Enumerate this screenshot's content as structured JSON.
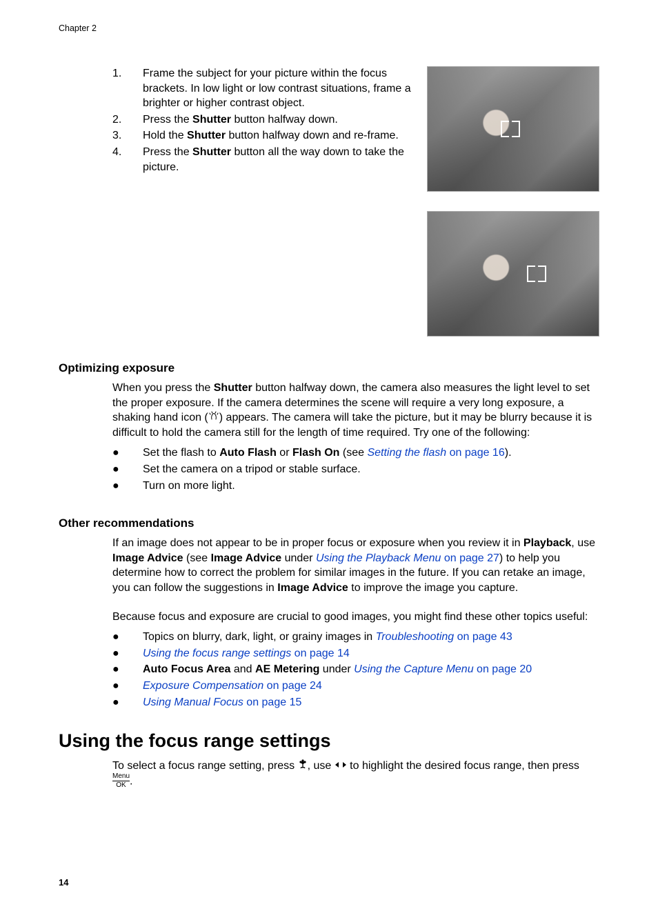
{
  "chapter_label": "Chapter 2",
  "steps": {
    "s1": {
      "num": "1.",
      "text_before": "Frame the subject for your picture within the focus brackets. In low light or low contrast situations, frame a brighter or higher contrast object."
    },
    "s2": {
      "num": "2.",
      "pre": "Press the ",
      "b1": "Shutter",
      "post": " button halfway down."
    },
    "s3": {
      "num": "3.",
      "pre": "Hold the ",
      "b1": "Shutter",
      "post": " button halfway down and re-frame."
    },
    "s4": {
      "num": "4.",
      "pre": "Press the ",
      "b1": "Shutter",
      "post": " button all the way down to take the picture."
    }
  },
  "optimizing": {
    "heading": "Optimizing exposure",
    "para_pre": "When you press the ",
    "para_b1": "Shutter",
    "para_mid": " button halfway down, the camera also measures the light level to set the proper exposure. If the camera determines the scene will require a very long exposure, a shaking hand icon (",
    "para_post": ") appears. The camera will take the picture, but it may be blurry because it is difficult to hold the camera still for the length of time required. Try one of the following:",
    "bullets": {
      "b1_pre": "Set the flash to ",
      "b1_bold1": "Auto Flash",
      "b1_mid": " or ",
      "b1_bold2": "Flash On",
      "b1_see": " (see ",
      "b1_link_em": "Setting the flash",
      "b1_link_tail": " on page 16",
      "b1_close": ").",
      "b2": "Set the camera on a tripod or stable surface.",
      "b3": "Turn on more light."
    }
  },
  "other": {
    "heading": "Other recommendations",
    "p1_pre": "If an image does not appear to be in proper focus or exposure when you review it in ",
    "p1_b1": "Playback",
    "p1_mid1": ", use ",
    "p1_b2": "Image Advice",
    "p1_mid2": " (see ",
    "p1_b3": "Image Advice",
    "p1_mid3": " under ",
    "p1_link_em": "Using the Playback Menu",
    "p1_link_tail": " on page 27",
    "p1_mid4": ") to help you determine how to correct the problem for similar images in the future. If you can retake an image, you can follow the suggestions in ",
    "p1_b4": "Image Advice",
    "p1_post": " to improve the image you capture.",
    "p2": "Because focus and exposure are crucial to good images, you might find these other topics useful:",
    "bullets": {
      "b1_pre": "Topics on blurry, dark, light, or grainy images in ",
      "b1_link_em": "Troubleshooting",
      "b1_link_tail": " on page 43",
      "b2_link_em": "Using the focus range settings",
      "b2_link_tail": " on page 14",
      "b3_bold1": "Auto Focus Area",
      "b3_mid": " and ",
      "b3_bold2": "AE Metering",
      "b3_under": " under ",
      "b3_link_em": "Using the Capture Menu",
      "b3_link_tail": " on page 20",
      "b4_link_em": "Exposure Compensation",
      "b4_link_tail": " on page 24",
      "b5_link_em": "Using Manual Focus",
      "b5_link_tail": " on page 15"
    }
  },
  "focus_range": {
    "heading": "Using the focus range settings",
    "p1_pre": "To select a focus range setting, press ",
    "p1_mid1": ", use ",
    "p1_mid2": " to highlight the desired focus range, then press ",
    "p1_post": ".",
    "menu_top": "Menu",
    "menu_bot": "OK"
  },
  "page_number": "14"
}
